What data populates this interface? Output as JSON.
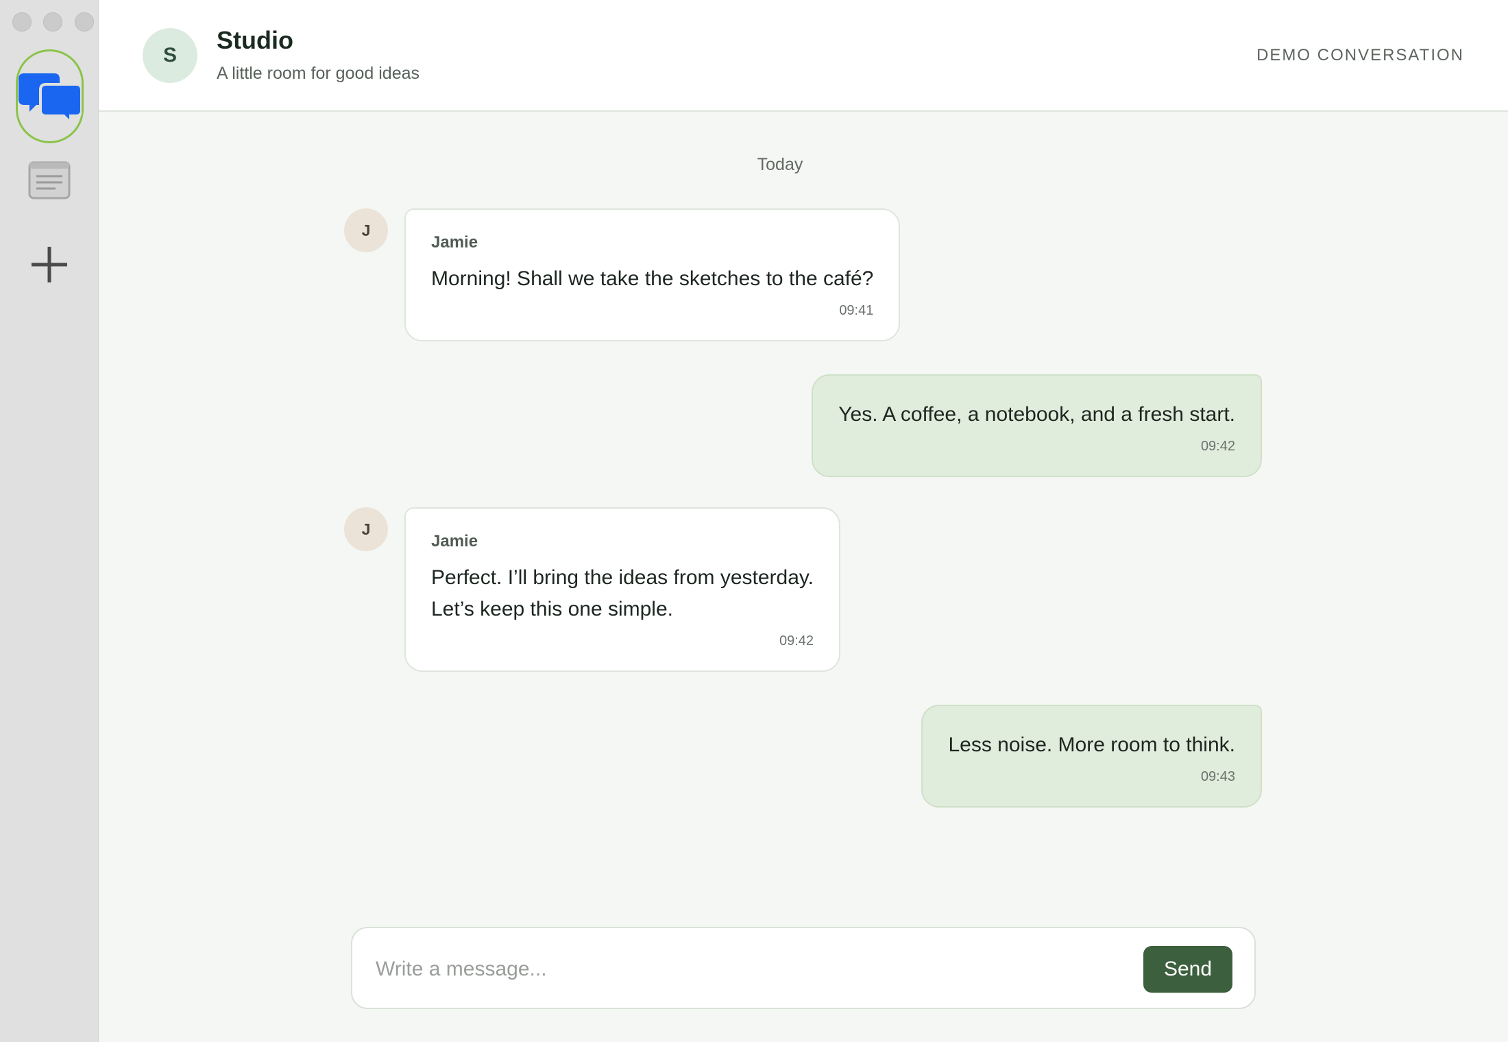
{
  "sidebar": {
    "items": [
      {
        "name": "chats",
        "icon": "chat-bubbles-icon",
        "active": true,
        "color": "#1a66f0"
      },
      {
        "name": "notes",
        "icon": "notes-icon"
      },
      {
        "name": "add",
        "icon": "plus-icon"
      }
    ]
  },
  "header": {
    "avatar_initial": "S",
    "title": "Studio",
    "subtitle": "A little room for good ideas",
    "right_label": "DEMO CONVERSATION"
  },
  "conversation": {
    "day_label": "Today",
    "messages": [
      {
        "direction": "in",
        "avatar_initial": "J",
        "sender": "Jamie",
        "text": "Morning! Shall we take the sketches to the café?",
        "time": "09:41"
      },
      {
        "direction": "out",
        "text": "Yes. A coffee, a notebook, and a fresh start.",
        "time": "09:42"
      },
      {
        "direction": "in",
        "avatar_initial": "J",
        "sender": "Jamie",
        "text": "Perfect. I’ll bring the ideas from yesterday.\nLet’s keep this one simple.",
        "time": "09:42"
      },
      {
        "direction": "out",
        "text": "Less noise. More room to think.",
        "time": "09:43"
      }
    ]
  },
  "composer": {
    "placeholder": "Write a message...",
    "value": "",
    "send_label": "Send"
  },
  "colors": {
    "accent_green": "#3c5f3d",
    "outgoing_bubble": "#e1eddc",
    "active_ring": "#8bc34a"
  }
}
